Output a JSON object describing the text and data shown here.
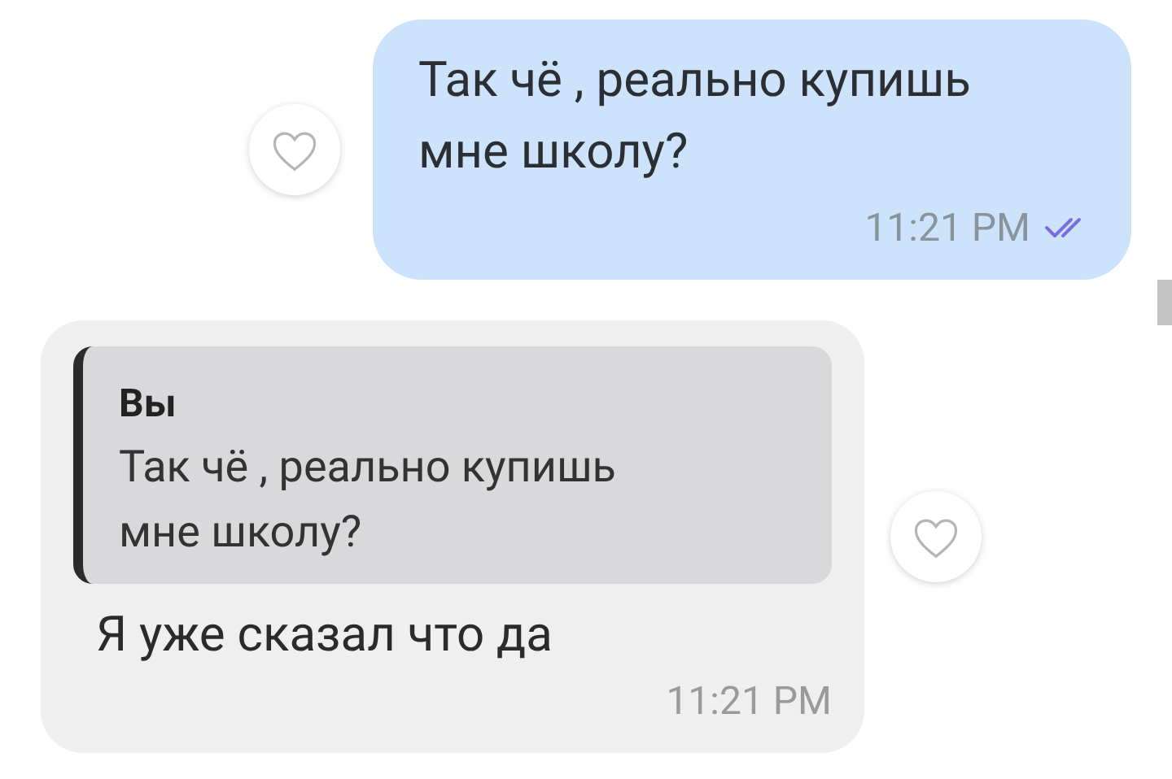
{
  "messages": [
    {
      "kind": "outgoing",
      "text": "Так чё , реально купишь мне школу?",
      "time": "11:21 PM",
      "read": true,
      "liked": false
    },
    {
      "kind": "incoming",
      "quote": {
        "author": "Вы",
        "text": "Так чё , реально купишь мне школу?"
      },
      "text": "Я уже сказал что да",
      "time": "11:21 PM",
      "liked": false
    }
  ]
}
